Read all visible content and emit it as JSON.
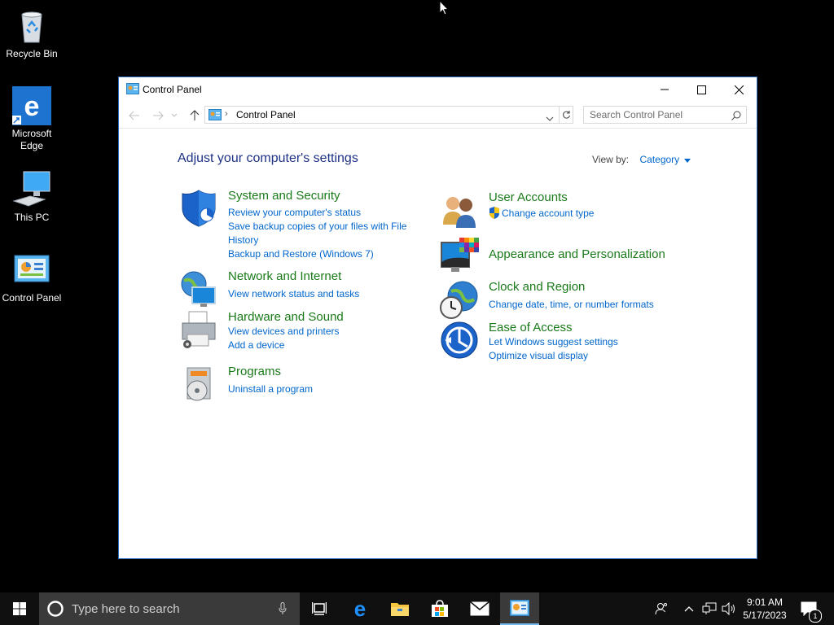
{
  "desktop": {
    "icons": [
      {
        "label": "Recycle Bin"
      },
      {
        "label": "Microsoft Edge"
      },
      {
        "label": "This PC"
      },
      {
        "label": "Control Panel"
      }
    ]
  },
  "window": {
    "title": "Control Panel",
    "breadcrumb": "Control Panel",
    "search_placeholder": "Search Control Panel",
    "heading": "Adjust your computer's settings",
    "view_by_label": "View by:",
    "view_by_value": "Category",
    "categories": [
      {
        "title": "System and Security",
        "icon": "shield-icon",
        "links": [
          "Review your computer's status",
          "Save backup copies of your files with File",
          "History",
          "Backup and Restore (Windows 7)"
        ]
      },
      {
        "title": "Network and Internet",
        "icon": "network-globe-icon",
        "links": [
          "View network status and tasks"
        ]
      },
      {
        "title": "Hardware and Sound",
        "icon": "printer-icon",
        "links": [
          "View devices and printers",
          "Add a device"
        ]
      },
      {
        "title": "Programs",
        "icon": "programs-disc-icon",
        "links": [
          "Uninstall a program"
        ]
      },
      {
        "title": "User Accounts",
        "icon": "users-icon",
        "links": [
          "Change account type"
        ]
      },
      {
        "title": "Appearance and Personalization",
        "icon": "monitor-palette-icon",
        "links": []
      },
      {
        "title": "Clock and Region",
        "icon": "clock-globe-icon",
        "links": [
          "Change date, time, or number formats"
        ]
      },
      {
        "title": "Ease of Access",
        "icon": "ease-of-access-icon",
        "links": [
          "Let Windows suggest settings",
          "Optimize visual display"
        ]
      }
    ]
  },
  "taskbar": {
    "search_placeholder": "Type here to search",
    "time": "9:01 AM",
    "date": "5/17/2023",
    "notification_count": "1"
  },
  "colors": {
    "category_title": "#1a7a1a",
    "link": "#0066cc",
    "heading": "#1e3287",
    "taskbar": "#101010"
  }
}
